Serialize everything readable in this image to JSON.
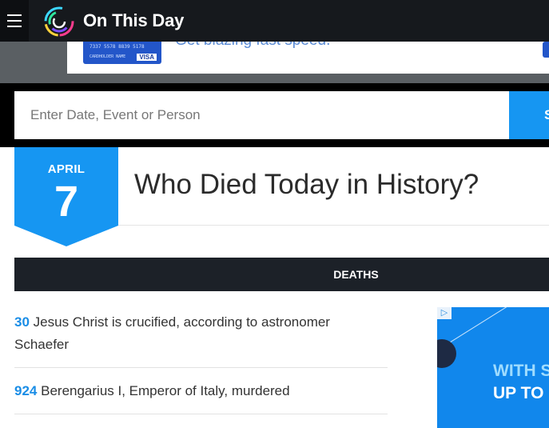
{
  "header": {
    "site_name": "On This Day",
    "menu_icon": "hamburger-menu-icon",
    "logo_icon": "rainbow-ring-logo-icon"
  },
  "top_ad": {
    "tagline": "Get blazing fast speed.",
    "card_brand": "VISA",
    "card_number": "7337 5578 8839 5178",
    "card_holder": "CARDHOLDER NAME"
  },
  "search": {
    "placeholder": "Enter Date, Event or Person",
    "button_label": "Search"
  },
  "date_badge": {
    "month": "APRIL",
    "day": "7"
  },
  "page_title": "Who Died Today in History?",
  "section": {
    "label": "DEATHS"
  },
  "events": [
    {
      "year": "30",
      "text": "Jesus Christ is crucified, according to astronomer Schaefer"
    },
    {
      "year": "924",
      "text": "Berengarius I, Emperor of Italy, murdered"
    }
  ],
  "side_ad": {
    "badge": "▷",
    "line1": "WITH S",
    "line2": "UP TO"
  },
  "colors": {
    "accent": "#1696f2",
    "header_bg": "#16191d",
    "section_bg": "#1c2128",
    "year_link": "#1a8de6"
  }
}
